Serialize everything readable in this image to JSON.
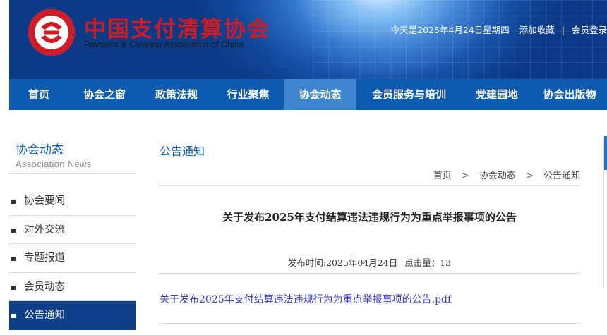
{
  "header": {
    "logo_cn": "中国支付清算协会",
    "logo_en": "Payment & Clearing Association of China",
    "date_text": "今天是2025年4月24日星期四",
    "bookmark_link": "添加收藏",
    "separator": "|",
    "login_link": "会员登录"
  },
  "nav": {
    "items": [
      "首页",
      "协会之窗",
      "政策法规",
      "行业聚焦",
      "协会动态",
      "会员服务与培训",
      "党建园地",
      "协会出版物"
    ],
    "active_index": 4
  },
  "sidebar": {
    "title": "协会动态",
    "subtitle": "Association News",
    "items": [
      "协会要闻",
      "对外交流",
      "专题报道",
      "会员动态",
      "公告通知"
    ],
    "active_index": 4
  },
  "main": {
    "section_title": "公告通知",
    "breadcrumb": [
      "首页",
      "协会动态",
      "公告通知"
    ],
    "breadcrumb_separator": ">",
    "article_title": "关于发布2025年支付结算违法违规行为为重点举报事项的公告",
    "publish_label": "发布时间:2025年04月24日",
    "clicks_label": "点击量：13",
    "attachment": "关于发布2025年支付结算违法违规行为为重点举报事项的公告.pdf"
  },
  "colors": {
    "nav_bg": "#0e5cb2",
    "nav_active": "#3d86cf",
    "sidebar_active": "#0e3f88",
    "logo_red": "#d11a23",
    "link_blue": "#3a3ad0"
  }
}
